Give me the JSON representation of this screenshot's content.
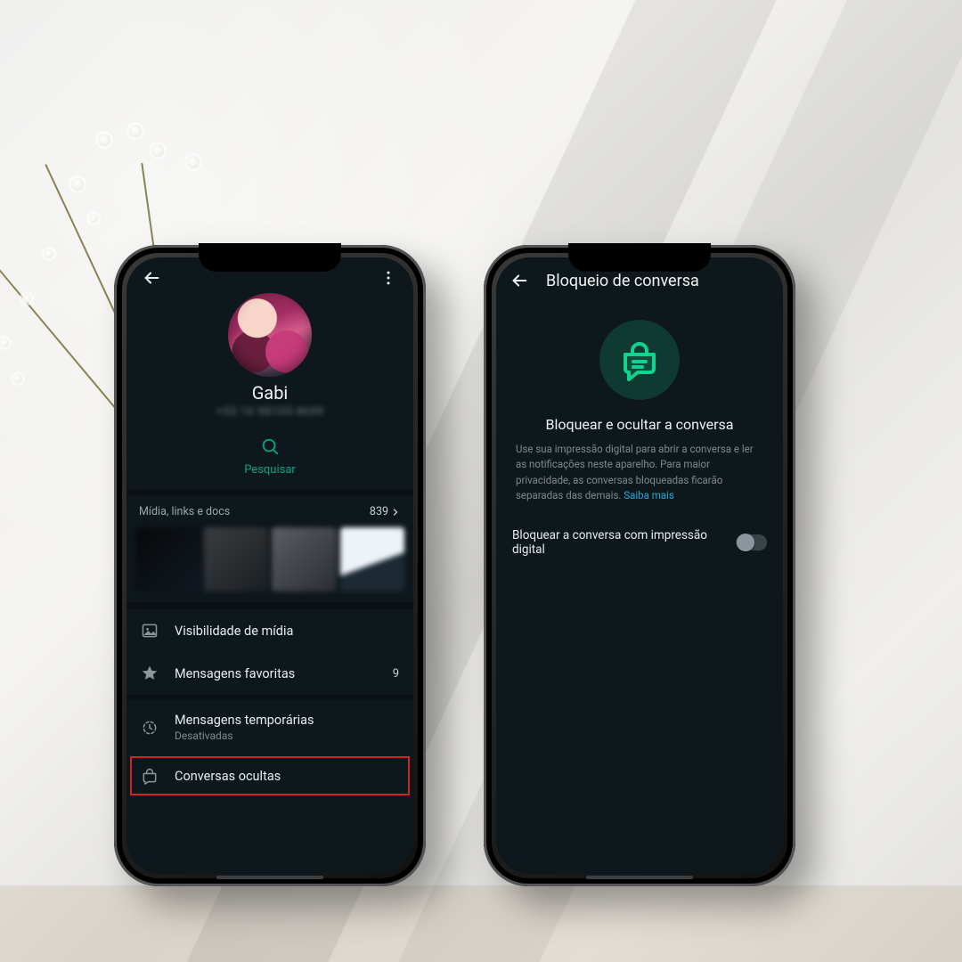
{
  "leftPhone": {
    "profile": {
      "name": "Gabi",
      "phone": "+55 16 98105-4699"
    },
    "search": {
      "label": "Pesquisar"
    },
    "media": {
      "header": "Mídia, links e docs",
      "count": "839"
    },
    "rows": {
      "visibility": {
        "label": "Visibilidade de mídia"
      },
      "favorites": {
        "label": "Mensagens favoritas",
        "count": "9"
      },
      "disappearing": {
        "label": "Mensagens temporárias",
        "sub": "Desativadas"
      },
      "hidden": {
        "label": "Conversas ocultas"
      }
    }
  },
  "rightPhone": {
    "header": {
      "title": "Bloqueio de conversa"
    },
    "hero": {
      "title": "Bloquear e ocultar a conversa",
      "desc": "Use sua impressão digital para abrir a conversa e ler as notificações neste aparelho. Para maior privacidade, as conversas bloqueadas ficarão separadas das demais.",
      "link": "Saiba mais"
    },
    "toggle": {
      "label": "Bloquear a conversa com impressão digital"
    }
  }
}
